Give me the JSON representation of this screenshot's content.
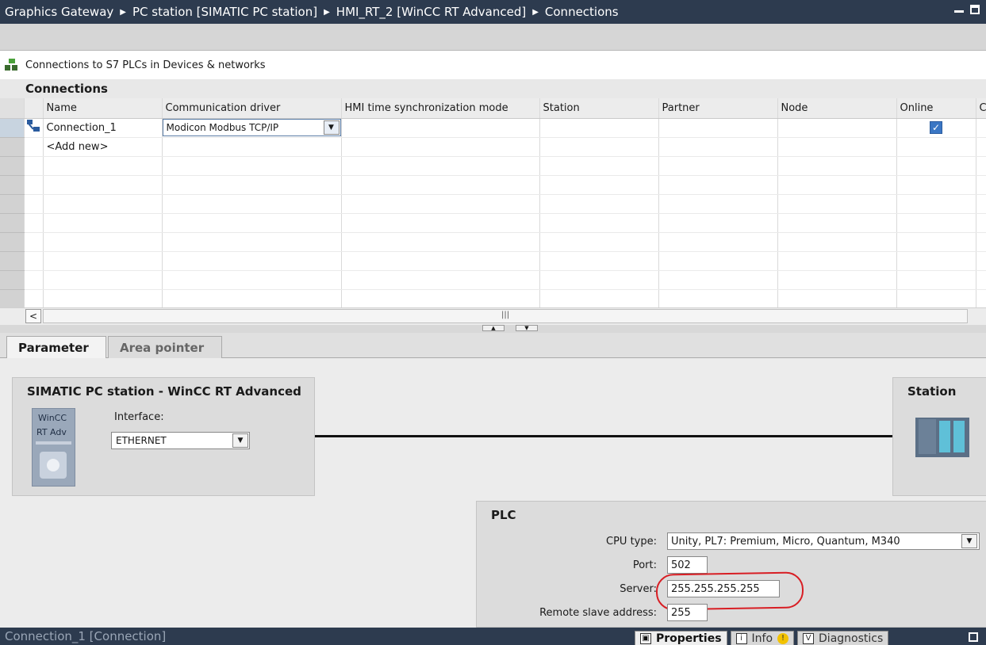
{
  "titlebar": {
    "crumbs": [
      "Graphics Gateway",
      "PC station [SIMATIC PC station]",
      "HMI_RT_2 [WinCC RT Advanced]",
      "Connections"
    ],
    "separator": "▶"
  },
  "section": {
    "link_text": "Connections to S7 PLCs in Devices & networks",
    "header": "Connections"
  },
  "table": {
    "columns": [
      "Name",
      "Communication driver",
      "HMI time synchronization mode",
      "Station",
      "Partner",
      "Node",
      "Online",
      "C"
    ],
    "rows": [
      {
        "name": "Connection_1",
        "driver": "Modicon Modbus TCP/IP",
        "time_sync": "",
        "station": "",
        "partner": "",
        "node": "",
        "online": true
      }
    ],
    "add_new": "<Add new>",
    "grip": "|||"
  },
  "tabs": {
    "active": "Parameter",
    "inactive": "Area pointer"
  },
  "left_box": {
    "title": "SIMATIC PC station - WinCC RT Advanced",
    "device_line1": "WinCC",
    "device_line2": "RT Adv",
    "interface_label": "Interface:",
    "interface_value": "ETHERNET"
  },
  "right_box": {
    "title": "Station"
  },
  "plc": {
    "title": "PLC",
    "cpu_type_label": "CPU type:",
    "cpu_type_value": "Unity, PL7: Premium, Micro, Quantum, M340",
    "port_label": "Port:",
    "port_value": "502",
    "server_label": "Server:",
    "server_value": "255.255.255.255",
    "slave_label": "Remote slave address:",
    "slave_value": "255"
  },
  "statusbar": {
    "left_text": "Connection_1 [Connection]",
    "properties": "Properties",
    "info": "Info",
    "diagnostics": "Diagnostics"
  },
  "colors": {
    "titlebar_bg": "#2d3b4f",
    "highlight_ring": "#d81e24",
    "checkbox": "#3a76c4"
  }
}
